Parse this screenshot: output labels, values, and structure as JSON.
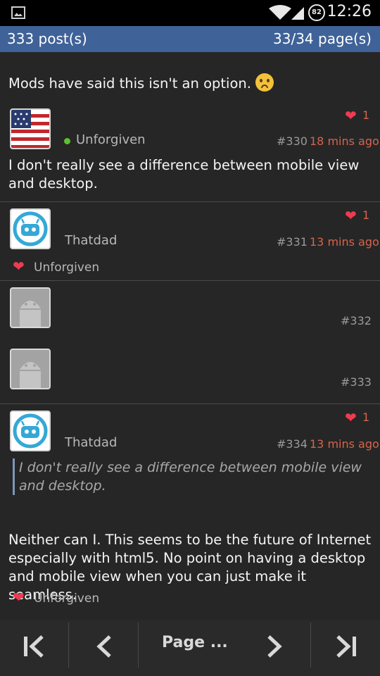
{
  "status": {
    "time": "12:26",
    "battery": "82",
    "icons": [
      "image-icon",
      "wifi-icon",
      "signal-icon",
      "battery-icon"
    ]
  },
  "header": {
    "posts": "333 post(s)",
    "pages": "33/34 page(s)"
  },
  "first_text": "Mods have said this isn't an option.",
  "posts": [
    {
      "user": "Unforgiven",
      "num": "#330",
      "time": "18 mins ago",
      "likes": "1",
      "body": "I don't really see a difference between mobile view and desktop."
    },
    {
      "user": "Thatdad",
      "num": "#331",
      "time": "13 mins ago",
      "likes": "1",
      "liked_by": "Unforgiven"
    },
    {
      "num": "#332"
    },
    {
      "num": "#333"
    },
    {
      "user": "Thatdad",
      "num": "#334",
      "time": "13 mins ago",
      "likes": "1",
      "quote": "I don't really see a difference between mobile view and desktop.",
      "body": "Neither can I. This seems to be the future of Internet especially with html5. No point on having a desktop and mobile view when you can just make it seamless.",
      "liked_by": "Unforgiven"
    }
  ],
  "nav": {
    "page_label": "Page ..."
  },
  "colors": {
    "header": "#3f6298",
    "accent": "#d6644c",
    "heart": "#ef3b52",
    "background": "#262626"
  }
}
